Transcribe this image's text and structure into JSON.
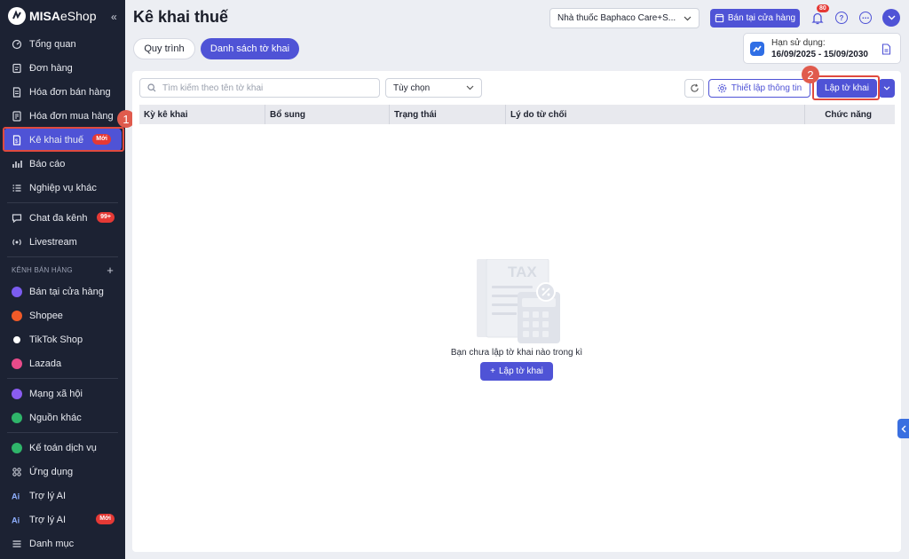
{
  "app": {
    "logo_bold": "MISA",
    "logo_thin": "eShop",
    "collapse": "«"
  },
  "sidebar": {
    "items_top": [
      {
        "label": "Tổng quan",
        "icon": "gauge-icon"
      },
      {
        "label": "Đơn hàng",
        "icon": "order-icon"
      },
      {
        "label": "Hóa đơn bán hàng",
        "icon": "invoice-icon"
      },
      {
        "label": "Hóa đơn mua hàng",
        "icon": "purchase-invoice-icon"
      },
      {
        "label": "Kê khai thuế",
        "icon": "tax-icon",
        "badge": "Mới",
        "active": true
      },
      {
        "label": "Báo cáo",
        "icon": "chart-icon"
      },
      {
        "label": "Nghiệp vụ khác",
        "icon": "list-icon"
      }
    ],
    "items_mid": [
      {
        "label": "Chat đa kênh",
        "icon": "chat-icon",
        "badge": "99+"
      },
      {
        "label": "Livestream",
        "icon": "live-icon"
      }
    ],
    "section_title": "KÊNH BÁN HÀNG",
    "section_plus": "+",
    "channels": [
      {
        "label": "Bán tại cửa hàng",
        "color": "#7b5cf0"
      },
      {
        "label": "Shopee",
        "color": "#f05a28"
      },
      {
        "label": "TikTok Shop",
        "color": "#ffffff"
      },
      {
        "label": "Lazada",
        "color": "#e94b8a"
      }
    ],
    "channels_more": [
      {
        "label": "Mạng xã hội",
        "color": "#8a5cf0"
      },
      {
        "label": "Nguồn khác",
        "color": "#2fb56a"
      }
    ],
    "items_bottom": [
      {
        "label": "Kế toán dịch vụ",
        "color": "#2fb56a"
      },
      {
        "label": "Ứng dụng",
        "icon": "apps-icon"
      },
      {
        "label": "Trợ lý AI",
        "icon": "ai-icon"
      },
      {
        "label": "Trợ lý AI",
        "icon": "ai-icon",
        "badge": "Mới"
      },
      {
        "label": "Danh mục",
        "icon": "menu-icon"
      }
    ]
  },
  "header": {
    "title": "Kê khai thuế",
    "store": "Nhà thuốc Baphaco Care+S...",
    "store_btn": "Bán tại cửa hàng",
    "notif_count": "80",
    "help": "?",
    "more": "⋯"
  },
  "tabs": [
    {
      "label": "Quy trình"
    },
    {
      "label": "Danh sách tờ khai"
    }
  ],
  "license": {
    "label": "Hạn sử dụng:",
    "dates": "16/09/2025 - 15/09/2030"
  },
  "toolbar": {
    "search_placeholder": "Tìm kiếm theo tên tờ khai",
    "options_label": "Tùy chọn",
    "setup_label": "Thiết lập thông tin",
    "create_label": "Lập tờ khai"
  },
  "table": {
    "columns": [
      "Kỳ kê khai",
      "Bổ sung",
      "Trạng thái",
      "Lý do từ chối",
      "Chức năng"
    ]
  },
  "empty": {
    "message": "Bạn chưa lập tờ khai nào trong kì",
    "button": "Lập tờ khai",
    "illus_text": "TAX"
  },
  "annotations": {
    "step1": "1",
    "step2": "2"
  },
  "colors": {
    "accent": "#4f53d6",
    "sidebar_bg": "#1c2233",
    "highlight": "#e04a3f"
  }
}
